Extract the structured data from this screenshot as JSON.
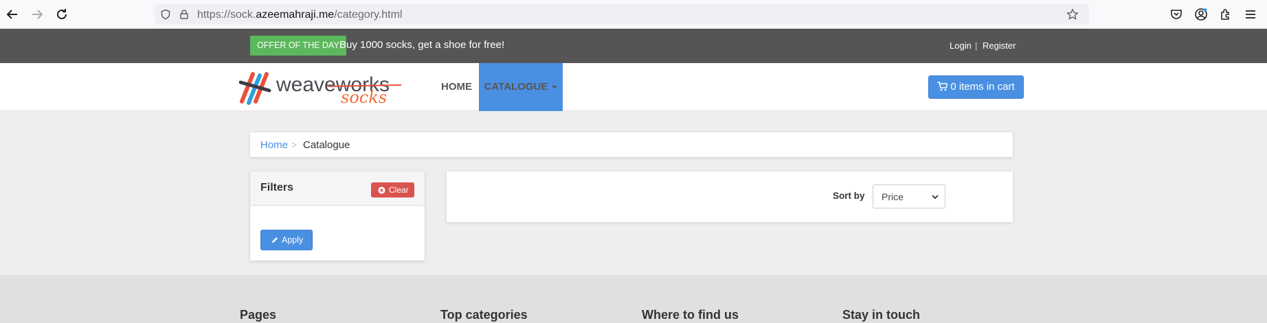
{
  "browser": {
    "url_prefix": "https://sock.",
    "url_domain": "azeemahraji.me",
    "url_path": "/category.html"
  },
  "topbar": {
    "offer_badge": "OFFER OF THE DAY",
    "offer_text": "Buy 1000 socks, get a shoe for free!",
    "login": "Login",
    "separator": "|",
    "register": "Register"
  },
  "header": {
    "logo_text_1": "weaveworks",
    "logo_text_2": "socks",
    "nav_home": "HOME",
    "nav_catalogue": "CATALOGUE",
    "cart": "0 items in cart"
  },
  "breadcrumb": {
    "home": "Home",
    "separator": ">",
    "current": "Catalogue"
  },
  "filters": {
    "title": "Filters",
    "clear": "Clear",
    "apply": "Apply"
  },
  "sort": {
    "label": "Sort by",
    "value": "Price"
  },
  "footer": {
    "col1": "Pages",
    "col2": "Top categories",
    "col3": "Where to find us",
    "col4": "Stay in touch"
  },
  "colors": {
    "accent": "#4a90e2",
    "offer_green": "#5cb85c",
    "danger": "#d9534f",
    "topbar": "#555555"
  }
}
